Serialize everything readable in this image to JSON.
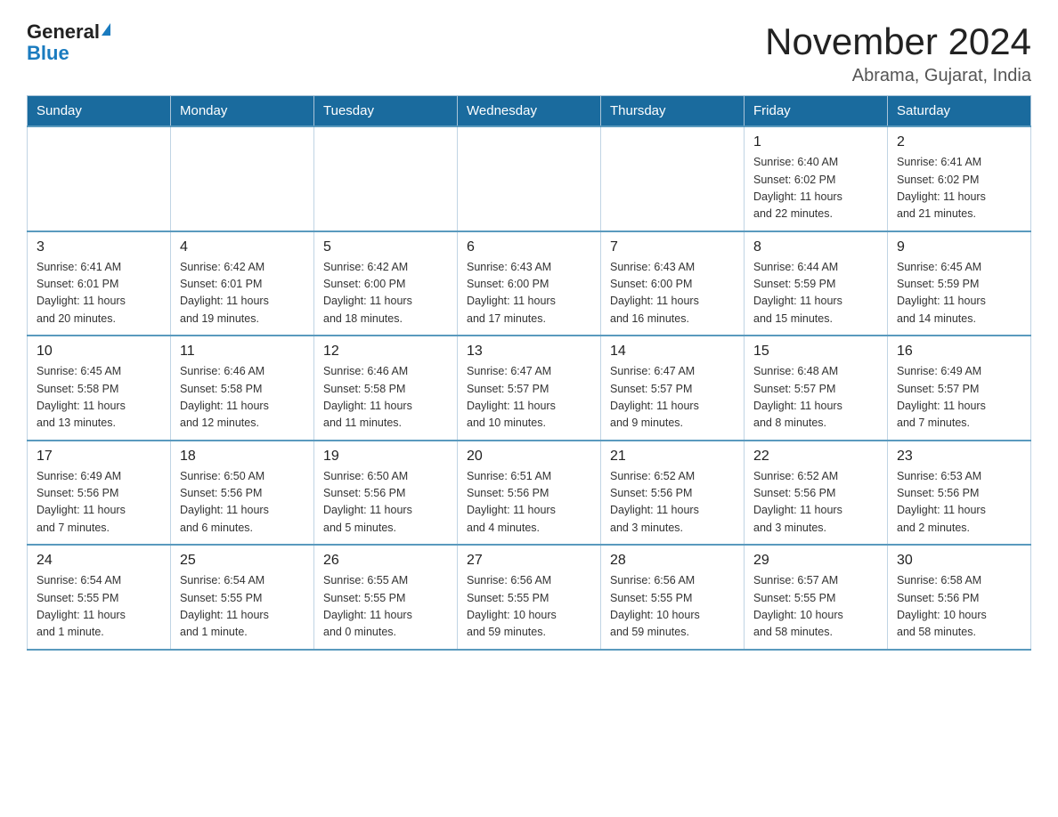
{
  "logo": {
    "general": "General",
    "blue": "Blue",
    "triangle": true
  },
  "title": "November 2024",
  "location": "Abrama, Gujarat, India",
  "weekdays": [
    "Sunday",
    "Monday",
    "Tuesday",
    "Wednesday",
    "Thursday",
    "Friday",
    "Saturday"
  ],
  "weeks": [
    [
      {
        "day": "",
        "info": ""
      },
      {
        "day": "",
        "info": ""
      },
      {
        "day": "",
        "info": ""
      },
      {
        "day": "",
        "info": ""
      },
      {
        "day": "",
        "info": ""
      },
      {
        "day": "1",
        "info": "Sunrise: 6:40 AM\nSunset: 6:02 PM\nDaylight: 11 hours\nand 22 minutes."
      },
      {
        "day": "2",
        "info": "Sunrise: 6:41 AM\nSunset: 6:02 PM\nDaylight: 11 hours\nand 21 minutes."
      }
    ],
    [
      {
        "day": "3",
        "info": "Sunrise: 6:41 AM\nSunset: 6:01 PM\nDaylight: 11 hours\nand 20 minutes."
      },
      {
        "day": "4",
        "info": "Sunrise: 6:42 AM\nSunset: 6:01 PM\nDaylight: 11 hours\nand 19 minutes."
      },
      {
        "day": "5",
        "info": "Sunrise: 6:42 AM\nSunset: 6:00 PM\nDaylight: 11 hours\nand 18 minutes."
      },
      {
        "day": "6",
        "info": "Sunrise: 6:43 AM\nSunset: 6:00 PM\nDaylight: 11 hours\nand 17 minutes."
      },
      {
        "day": "7",
        "info": "Sunrise: 6:43 AM\nSunset: 6:00 PM\nDaylight: 11 hours\nand 16 minutes."
      },
      {
        "day": "8",
        "info": "Sunrise: 6:44 AM\nSunset: 5:59 PM\nDaylight: 11 hours\nand 15 minutes."
      },
      {
        "day": "9",
        "info": "Sunrise: 6:45 AM\nSunset: 5:59 PM\nDaylight: 11 hours\nand 14 minutes."
      }
    ],
    [
      {
        "day": "10",
        "info": "Sunrise: 6:45 AM\nSunset: 5:58 PM\nDaylight: 11 hours\nand 13 minutes."
      },
      {
        "day": "11",
        "info": "Sunrise: 6:46 AM\nSunset: 5:58 PM\nDaylight: 11 hours\nand 12 minutes."
      },
      {
        "day": "12",
        "info": "Sunrise: 6:46 AM\nSunset: 5:58 PM\nDaylight: 11 hours\nand 11 minutes."
      },
      {
        "day": "13",
        "info": "Sunrise: 6:47 AM\nSunset: 5:57 PM\nDaylight: 11 hours\nand 10 minutes."
      },
      {
        "day": "14",
        "info": "Sunrise: 6:47 AM\nSunset: 5:57 PM\nDaylight: 11 hours\nand 9 minutes."
      },
      {
        "day": "15",
        "info": "Sunrise: 6:48 AM\nSunset: 5:57 PM\nDaylight: 11 hours\nand 8 minutes."
      },
      {
        "day": "16",
        "info": "Sunrise: 6:49 AM\nSunset: 5:57 PM\nDaylight: 11 hours\nand 7 minutes."
      }
    ],
    [
      {
        "day": "17",
        "info": "Sunrise: 6:49 AM\nSunset: 5:56 PM\nDaylight: 11 hours\nand 7 minutes."
      },
      {
        "day": "18",
        "info": "Sunrise: 6:50 AM\nSunset: 5:56 PM\nDaylight: 11 hours\nand 6 minutes."
      },
      {
        "day": "19",
        "info": "Sunrise: 6:50 AM\nSunset: 5:56 PM\nDaylight: 11 hours\nand 5 minutes."
      },
      {
        "day": "20",
        "info": "Sunrise: 6:51 AM\nSunset: 5:56 PM\nDaylight: 11 hours\nand 4 minutes."
      },
      {
        "day": "21",
        "info": "Sunrise: 6:52 AM\nSunset: 5:56 PM\nDaylight: 11 hours\nand 3 minutes."
      },
      {
        "day": "22",
        "info": "Sunrise: 6:52 AM\nSunset: 5:56 PM\nDaylight: 11 hours\nand 3 minutes."
      },
      {
        "day": "23",
        "info": "Sunrise: 6:53 AM\nSunset: 5:56 PM\nDaylight: 11 hours\nand 2 minutes."
      }
    ],
    [
      {
        "day": "24",
        "info": "Sunrise: 6:54 AM\nSunset: 5:55 PM\nDaylight: 11 hours\nand 1 minute."
      },
      {
        "day": "25",
        "info": "Sunrise: 6:54 AM\nSunset: 5:55 PM\nDaylight: 11 hours\nand 1 minute."
      },
      {
        "day": "26",
        "info": "Sunrise: 6:55 AM\nSunset: 5:55 PM\nDaylight: 11 hours\nand 0 minutes."
      },
      {
        "day": "27",
        "info": "Sunrise: 6:56 AM\nSunset: 5:55 PM\nDaylight: 10 hours\nand 59 minutes."
      },
      {
        "day": "28",
        "info": "Sunrise: 6:56 AM\nSunset: 5:55 PM\nDaylight: 10 hours\nand 59 minutes."
      },
      {
        "day": "29",
        "info": "Sunrise: 6:57 AM\nSunset: 5:55 PM\nDaylight: 10 hours\nand 58 minutes."
      },
      {
        "day": "30",
        "info": "Sunrise: 6:58 AM\nSunset: 5:56 PM\nDaylight: 10 hours\nand 58 minutes."
      }
    ]
  ]
}
